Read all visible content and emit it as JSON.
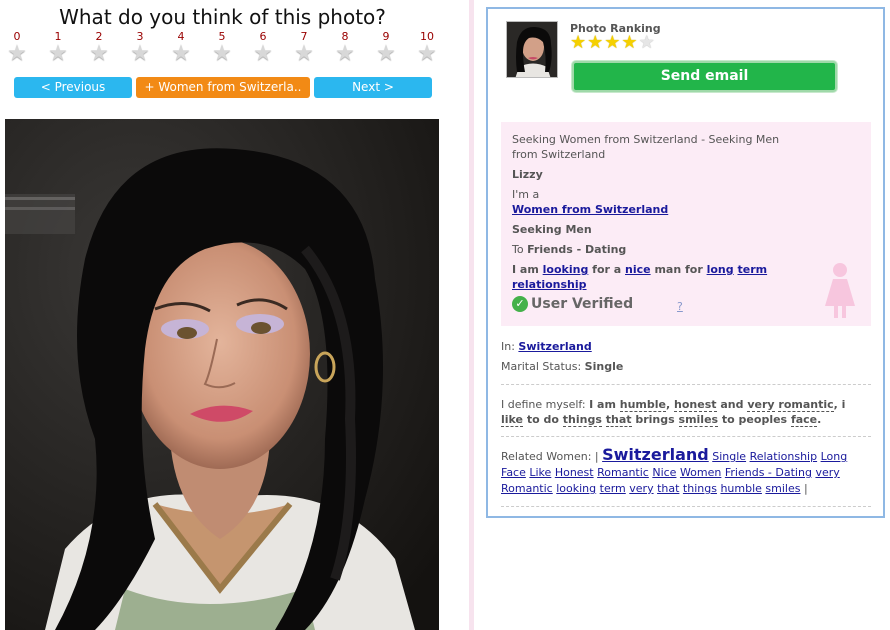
{
  "rating": {
    "question": "What do you think of this photo?",
    "scale": [
      "0",
      "1",
      "2",
      "3",
      "4",
      "5",
      "6",
      "7",
      "8",
      "9",
      "10"
    ]
  },
  "nav": {
    "previous": "< Previous",
    "category": "+ Women from Switzerla..",
    "next": "Next >"
  },
  "panel": {
    "ranking_label": "Photo Ranking",
    "ranking_stars": 4,
    "ranking_max": 5,
    "send_email": "Send email",
    "seeking_line1": "Seeking Women from Switzerland - Seeking Men",
    "seeking_line2": "from Switzerland",
    "name": "Lizzy",
    "im_a": "I'm a",
    "category_link": "Women from Switzerland",
    "seeking_label": "Seeking Men",
    "to_prefix": "To ",
    "to_value": "Friends - Dating",
    "desc_1": "I am ",
    "desc_link_1": "looking",
    "desc_2": " for a ",
    "desc_link_2": "nice",
    "desc_3": " man for ",
    "desc_link_3": "long",
    "desc_link_4": "term",
    "desc_link_5": "relationship",
    "verified": "User Verified",
    "help": "?",
    "in_label": "In: ",
    "in_value": "Switzerland",
    "marital_label": "Marital Status: ",
    "marital_value": "Single",
    "define_label": "I define myself: ",
    "define_parts": [
      "I am ",
      "humble",
      ", ",
      "honest",
      " and ",
      "very",
      " ",
      "romantic",
      ", i ",
      "like",
      " to do ",
      "things",
      " ",
      "that",
      " brings ",
      "smiles",
      " to peoples ",
      "face",
      "."
    ],
    "related_label": "Related Women: | ",
    "related_big": "Switzerland",
    "related_links": [
      "Single",
      "Relationship",
      "Long",
      "Face",
      "Like",
      "Honest",
      "Romantic",
      "Nice",
      "Women",
      "Friends - Dating",
      "very",
      "Romantic",
      "looking",
      "term",
      "very",
      "that",
      "things",
      "humble",
      "smiles"
    ],
    "related_end": " |"
  },
  "colors": {
    "nav_blue": "#2bb7ef",
    "nav_orange": "#f28a15",
    "send_green": "#22b54a",
    "panel_border": "#8fb8e4",
    "pink_box": "#fcecf6",
    "link": "#1a1a9c"
  }
}
